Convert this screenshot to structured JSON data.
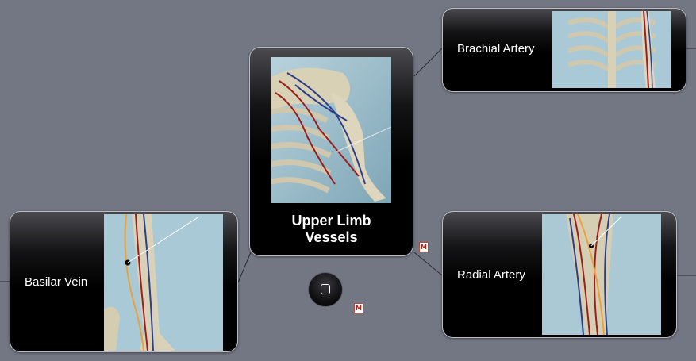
{
  "map": {
    "central_node": {
      "title_line1": "Upper Limb",
      "title_line2": "Vessels",
      "image_icon": "upper-limb-skeleton-vessels-image"
    },
    "nodes": [
      {
        "id": "brachial-artery",
        "label": "Brachial Artery",
        "image_icon": "thorax-skeleton-image"
      },
      {
        "id": "radial-artery",
        "label": "Radial Artery",
        "image_icon": "forearm-vessels-image"
      },
      {
        "id": "basilar-vein",
        "label": "Basilar Vein",
        "image_icon": "arm-vein-image"
      }
    ],
    "home_button_icon": "home-square-icon",
    "note_icon_glyph": "M",
    "colors": {
      "background": "#737783",
      "node_fill": "#000000",
      "node_border": "#b9bcc4",
      "artery": "#9a1f1f",
      "vein": "#2d3f8a",
      "nerve": "#e9a23b",
      "image_bg": "#a9c9d6",
      "bone": "#dcd6bf"
    }
  }
}
